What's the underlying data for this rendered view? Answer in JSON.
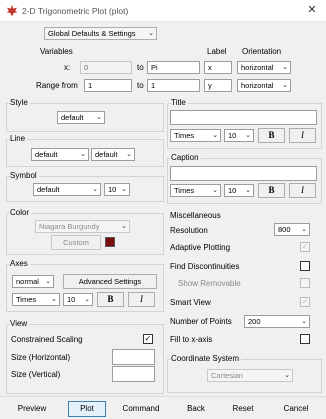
{
  "window": {
    "title": "2-D Trigonometric Plot (plot)",
    "close_glyph": "✕"
  },
  "global_defaults": {
    "value": "Global Defaults & Settings"
  },
  "variables": {
    "heading": "Variables",
    "label_heading": "Label",
    "orientation_heading": "Orientation",
    "x_label": "x:",
    "x_from": "0",
    "to_text": "to",
    "x_to": "Pi",
    "x_axis_label": "x",
    "x_orientation": "horizontal",
    "range_label": "Range from",
    "y_from": "1",
    "y_to": "1",
    "y_axis_label": "y",
    "y_orientation": "horizontal"
  },
  "style": {
    "heading": "Style",
    "value": "default"
  },
  "line": {
    "heading": "Line",
    "style_value": "default",
    "thickness_value": "default"
  },
  "symbol": {
    "heading": "Symbol",
    "value": "default",
    "size": "10"
  },
  "color": {
    "heading": "Color",
    "value": "Niagara Burgundy",
    "custom_label": "Custom",
    "swatch_color": "#7a0f12"
  },
  "axes": {
    "heading": "Axes",
    "value": "normal",
    "advanced_label": "Advanced Settings",
    "font": "Times",
    "size": "10",
    "bold_label": "B",
    "italic_label": "I"
  },
  "view": {
    "heading": "View",
    "constrained_label": "Constrained Scaling",
    "constrained_checked": "✓",
    "size_h_label": "Size (Horizontal)",
    "size_h_value": "",
    "size_v_label": "Size (Vertical)",
    "size_v_value": ""
  },
  "title_section": {
    "heading": "Title",
    "value": "",
    "font": "Times",
    "size": "10",
    "bold_label": "B",
    "italic_label": "I"
  },
  "caption_section": {
    "heading": "Caption",
    "value": "",
    "font": "Times",
    "size": "10",
    "bold_label": "B",
    "italic_label": "I"
  },
  "misc": {
    "heading": "Miscellaneous",
    "resolution_label": "Resolution",
    "resolution_value": "800",
    "adaptive_label": "Adaptive Plotting",
    "adaptive_checked": "✓",
    "discont_label": "Find Discontinuities",
    "removable_label": "Show Removable",
    "smart_label": "Smart View",
    "smart_checked": "✓",
    "points_label": "Number of Points",
    "points_value": "200",
    "fill_label": "Fill to x-axis"
  },
  "coords": {
    "heading": "Coordinate System",
    "value": "Cartesian"
  },
  "bottom": {
    "preview": "Preview",
    "plot": "Plot",
    "command": "Command",
    "back": "Back",
    "reset": "Reset",
    "cancel": "Cancel"
  },
  "caret_glyph": "⌄"
}
